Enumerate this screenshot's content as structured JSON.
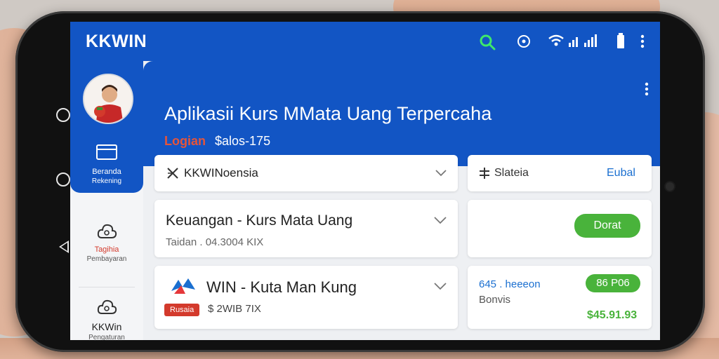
{
  "statusbar": {
    "brand": "KKWIN",
    "icons": [
      "search-icon",
      "alarm-icon",
      "wifi-icon",
      "signal-icon",
      "battery-icon",
      "more-vert-icon"
    ]
  },
  "sidebar": {
    "avatar_icon": "user-avatar",
    "items": [
      {
        "icon": "wallet-icon",
        "label": "Beranda",
        "sub": "Rekening",
        "active": true
      },
      {
        "icon": "cloud-icon",
        "label": "Tagihia",
        "sub": "Pembayaran",
        "active": false
      },
      {
        "icon": "cloud-icon",
        "label": "KKWin",
        "sub": "Pengaturan",
        "active": false
      }
    ]
  },
  "banner": {
    "title": "Aplikasii Kurs MMata Uang Terpercaha",
    "login": "Logian",
    "saldo": "$alos-175"
  },
  "cards": {
    "card1": {
      "icon": "x-icon",
      "label": "KKWINoensia"
    },
    "card2": {
      "icon": "exchange-icon",
      "label": "Slateia",
      "action": "Eubal"
    },
    "card3": {
      "title": "Keuangan - Kurs Mata Uang",
      "sub": "Taidan . 04.3004 KIX"
    },
    "card4": {
      "button": "Dorat"
    },
    "card5": {
      "title": "WIN - Kuta Man Kung",
      "badge": "Rusaia",
      "sub": "$ 2WIB 7IX"
    },
    "card6": {
      "line1": "645 . heeeon",
      "line2": "Bonvis",
      "pill": "86 P06",
      "amount": "$45.91.93"
    }
  },
  "colors": {
    "primary": "#1255c4",
    "accent_green": "#49b33b",
    "accent_red": "#e5553a",
    "link_blue": "#1a6fd0"
  }
}
